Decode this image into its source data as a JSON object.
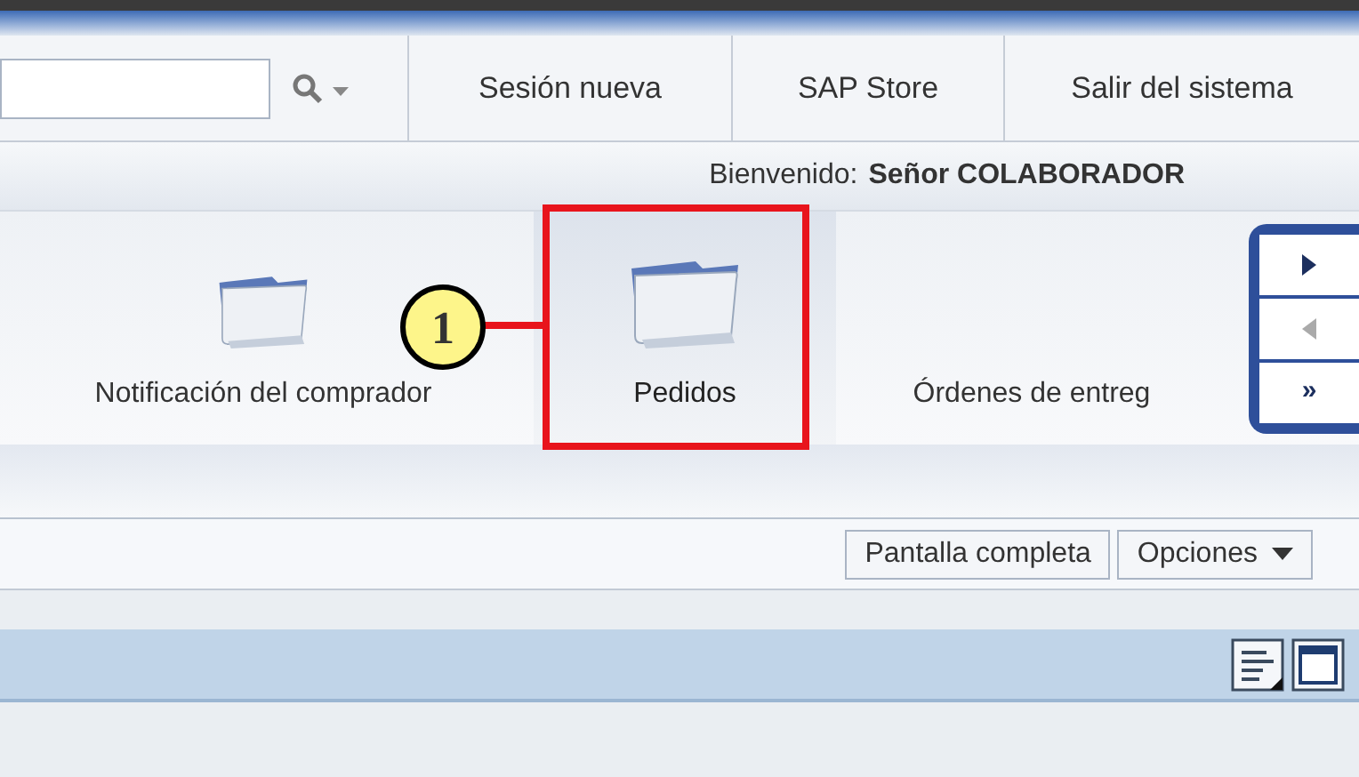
{
  "header": {
    "links": [
      "Sesión nueva",
      "SAP Store",
      "Salir del sistema"
    ]
  },
  "welcome": {
    "label": "Bienvenido:",
    "user": "Señor COLABORADOR"
  },
  "nav": {
    "items": [
      {
        "label": "Notificación del comprador",
        "selected": false,
        "kind": "folder"
      },
      {
        "label": "Pedidos",
        "selected": true,
        "kind": "folder"
      },
      {
        "label": "Órdenes de entreg",
        "selected": false,
        "kind": "plain"
      }
    ],
    "controls": {
      "forward_disabled": false,
      "back_disabled": true,
      "more": "»"
    }
  },
  "callout": {
    "number": "1"
  },
  "toolbar": {
    "buttons": [
      {
        "label": "Pantalla completa",
        "kind": "plain"
      },
      {
        "label": "Opciones",
        "kind": "menu"
      }
    ]
  }
}
